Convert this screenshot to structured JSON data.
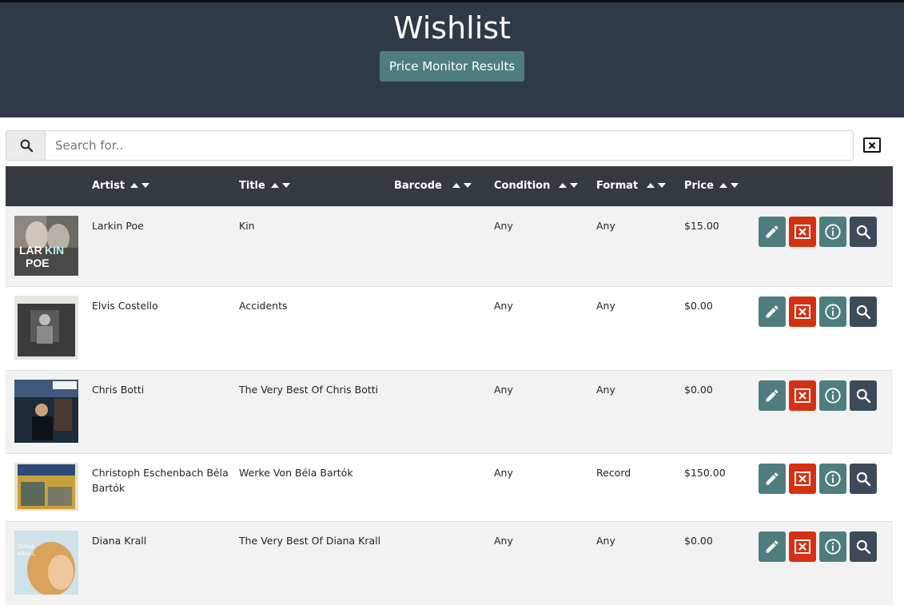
{
  "header": {
    "title": "Wishlist",
    "price_monitor_label": "Price Monitor Results"
  },
  "search": {
    "placeholder": "Search for..",
    "value": ""
  },
  "table": {
    "columns": [
      "Artist",
      "Title",
      "Barcode",
      "Condition",
      "Format",
      "Price"
    ],
    "rows": [
      {
        "artist": "Larkin Poe",
        "title": "Kin",
        "barcode": "",
        "condition": "Any",
        "format": "Any",
        "price": "$15.00"
      },
      {
        "artist": "Elvis Costello",
        "title": "Accidents",
        "barcode": "",
        "condition": "Any",
        "format": "Any",
        "price": "$0.00"
      },
      {
        "artist": "Chris Botti",
        "title": "The Very Best Of Chris Botti",
        "barcode": "",
        "condition": "Any",
        "format": "Any",
        "price": "$0.00"
      },
      {
        "artist": "Christoph Eschenbach Béla Bartók",
        "title": "Werke Von Béla Bartók",
        "barcode": "",
        "condition": "Any",
        "format": "Record",
        "price": "$150.00"
      },
      {
        "artist": "Diana Krall",
        "title": "The Very Best Of Diana Krall",
        "barcode": "",
        "condition": "Any",
        "format": "Any",
        "price": "$0.00"
      }
    ]
  },
  "icons": {
    "search": "search-icon",
    "clear": "clear-search-icon",
    "edit": "pencil-icon",
    "delete": "close-box-icon",
    "info": "info-icon",
    "lookup": "magnifier-icon"
  },
  "colors": {
    "header_bg": "#2f3a48",
    "accent": "#4f7d7f",
    "danger": "#d63012",
    "table_head": "#343a40",
    "dark_button": "#3d4a5a"
  }
}
